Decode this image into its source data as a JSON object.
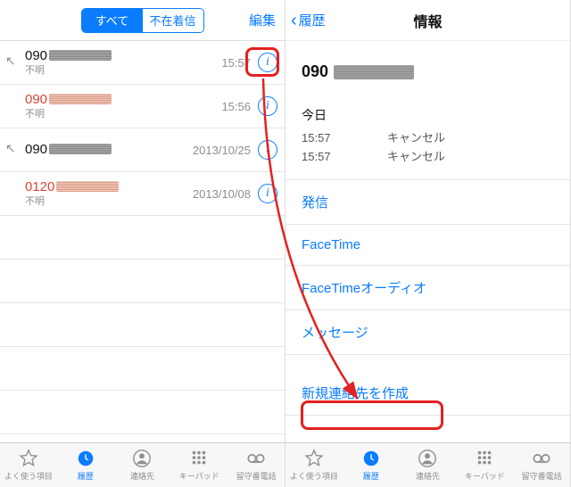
{
  "left": {
    "segmented": {
      "all": "すべて",
      "missed": "不在着信"
    },
    "edit": "編集",
    "calls": [
      {
        "number": "090",
        "subtitle": "不明",
        "meta": "15:57",
        "missed": false,
        "outgoing": true
      },
      {
        "number": "090",
        "subtitle": "不明",
        "meta": "15:56",
        "missed": true,
        "outgoing": false
      },
      {
        "number": "090",
        "subtitle": "",
        "meta": "2013/10/25",
        "missed": false,
        "outgoing": true
      },
      {
        "number": "0120",
        "subtitle": "不明",
        "meta": "2013/10/08",
        "missed": true,
        "outgoing": false
      }
    ]
  },
  "right": {
    "back": "履歴",
    "title": "情報",
    "phone": "090",
    "today": "今日",
    "log": [
      {
        "time": "15:57",
        "status": "キャンセル"
      },
      {
        "time": "15:57",
        "status": "キャンセル"
      }
    ],
    "actions": [
      "発信",
      "FaceTime",
      "FaceTimeオーディオ",
      "メッセージ"
    ],
    "create": "新規連絡先を作成"
  },
  "tabs": {
    "favorites": "よく使う項目",
    "recents": "履歴",
    "contacts": "連絡先",
    "keypad": "キーパッド",
    "voicemail": "留守番電話"
  },
  "icons": {
    "info": "i",
    "chevron": "‹"
  }
}
